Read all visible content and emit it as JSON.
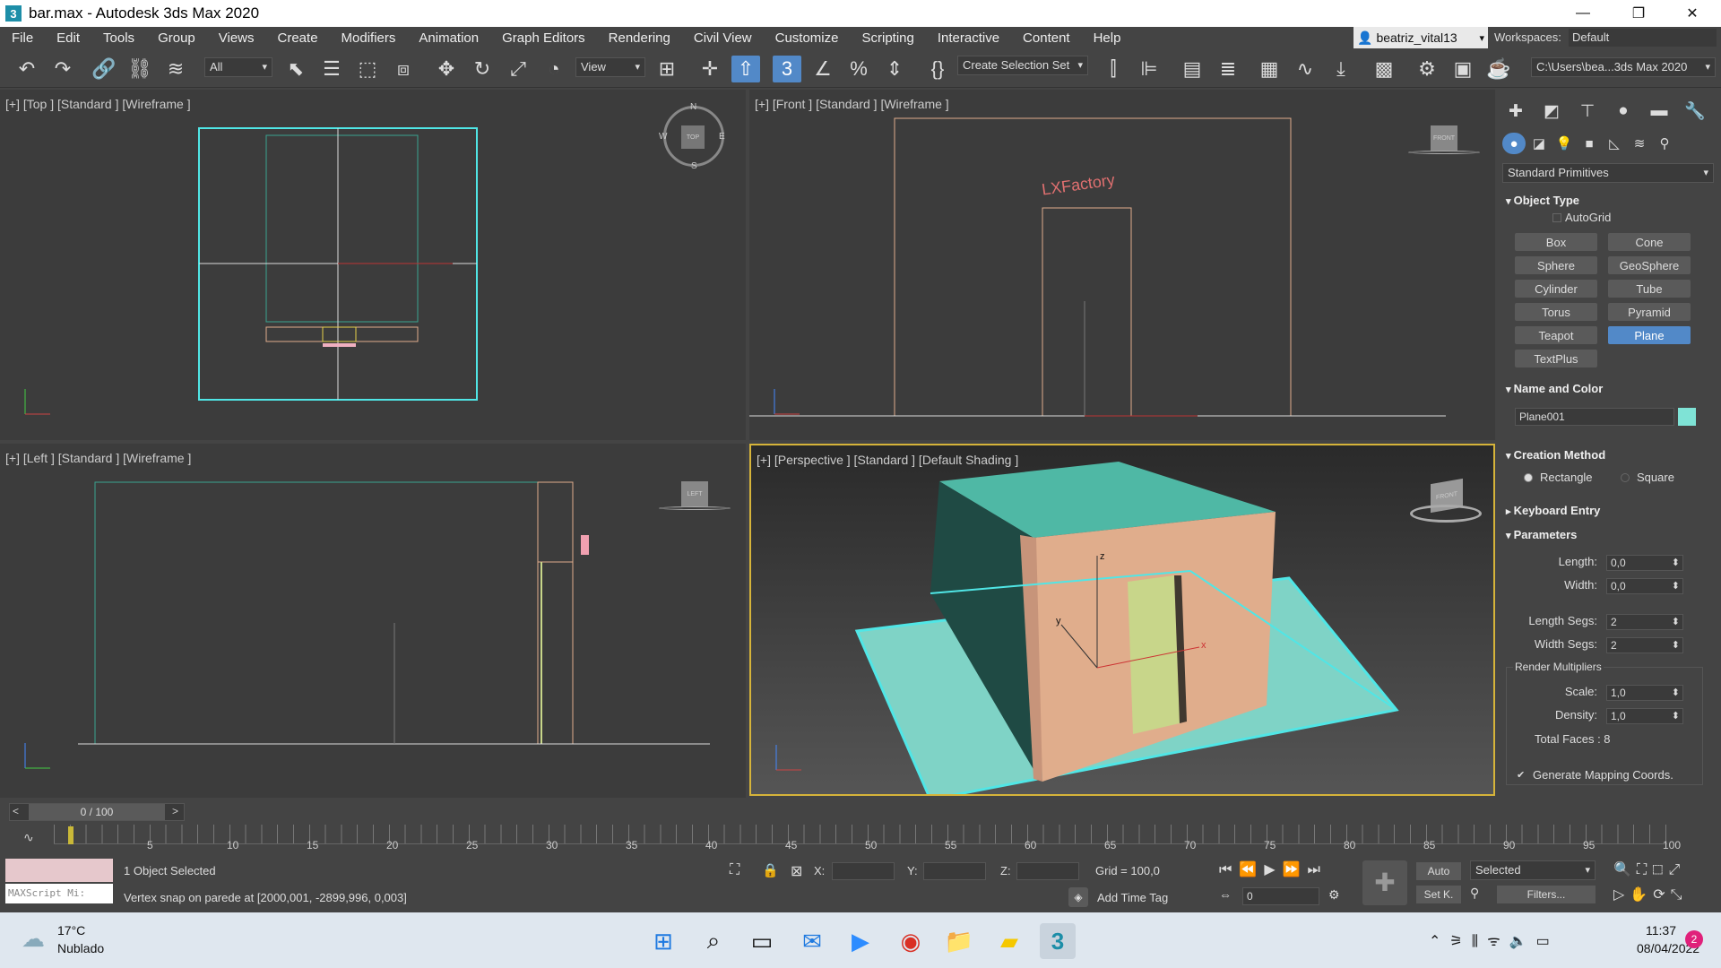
{
  "window": {
    "title": "bar.max - Autodesk 3ds Max 2020",
    "icon": "3"
  },
  "menu": [
    "File",
    "Edit",
    "Tools",
    "Group",
    "Views",
    "Create",
    "Modifiers",
    "Animation",
    "Graph Editors",
    "Rendering",
    "Civil View",
    "Customize",
    "Scripting",
    "Interactive",
    "Content",
    "Help"
  ],
  "user": {
    "name": "beatriz_vital13",
    "icon": "user-icon"
  },
  "workspaces": {
    "label": "Workspaces:",
    "value": "Default"
  },
  "toolbar": {
    "filter": "All",
    "ref_coord": "View",
    "selection_set": "Create Selection Set",
    "project_path": "C:\\Users\\bea...3ds Max 2020"
  },
  "viewports": {
    "top": "[+] [Top ] [Standard ] [Wireframe ]",
    "front": "[+] [Front ] [Standard ] [Wireframe ]",
    "left": "[+] [Left ] [Standard ] [Wireframe ]",
    "perspective": "[+] [Perspective ] [Standard ] [Default Shading ]",
    "compass": {
      "n": "N",
      "s": "S",
      "e": "E",
      "w": "W",
      "top": "TOP"
    },
    "viewcube_front": "FRONT",
    "viewcube_left": "LEFT",
    "viewcube_persp": "FRONT",
    "sign_text": "LXFactory",
    "axis": {
      "x": "x",
      "y": "y",
      "z": "z"
    }
  },
  "command_panel": {
    "category": "Standard Primitives",
    "object_type": {
      "title": "Object Type",
      "autogrid": "AutoGrid",
      "buttons": [
        "Box",
        "Cone",
        "Sphere",
        "GeoSphere",
        "Cylinder",
        "Tube",
        "Torus",
        "Pyramid",
        "Teapot",
        "Plane",
        "TextPlus"
      ]
    },
    "name_color": {
      "title": "Name and Color",
      "name": "Plane001",
      "color": "#7fe3d6"
    },
    "creation_method": {
      "title": "Creation Method",
      "opt1": "Rectangle",
      "opt2": "Square"
    },
    "keyboard_entry": "Keyboard Entry",
    "parameters": {
      "title": "Parameters",
      "length_label": "Length:",
      "length": "0,0",
      "width_label": "Width:",
      "width": "0,0",
      "length_segs_label": "Length Segs:",
      "length_segs": "2",
      "width_segs_label": "Width Segs:",
      "width_segs": "2",
      "render_mult": "Render Multipliers",
      "scale_label": "Scale:",
      "scale": "1,0",
      "density_label": "Density:",
      "density": "1,0",
      "total_faces": "Total Faces : 8",
      "gen_mapping": "Generate Mapping Coords."
    }
  },
  "timeline": {
    "frame": "0 / 100",
    "prev": "<",
    "next": ">",
    "ticks": [
      "5",
      "10",
      "15",
      "20",
      "25",
      "30",
      "35",
      "40",
      "45",
      "50",
      "55",
      "60",
      "65",
      "70",
      "75",
      "80",
      "85",
      "90",
      "95",
      "100"
    ]
  },
  "status": {
    "selected": "1 Object Selected",
    "prompt": "Vertex snap on parede at [2000,001, -2899,996, 0,003]",
    "maxscript": "MAXScript Mi:",
    "x_label": "X:",
    "y_label": "Y:",
    "z_label": "Z:",
    "grid": "Grid = 100,0",
    "add_time_tag": "Add Time Tag",
    "auto": "Auto",
    "set_key": "Set K.",
    "key_filter": "Selected",
    "filters": "Filters...",
    "frame_field": "0"
  },
  "taskbar": {
    "weather_temp": "17°C",
    "weather_desc": "Nublado",
    "time": "11:37",
    "date": "08/04/2022",
    "notif": "2"
  },
  "colors": {
    "accent": "#5289c8",
    "selection": "#50e6e6",
    "wall": "#e0ad8c",
    "roof": "#4fb8a5",
    "plane": "#7fd3c6",
    "door": "#c8d68a"
  }
}
